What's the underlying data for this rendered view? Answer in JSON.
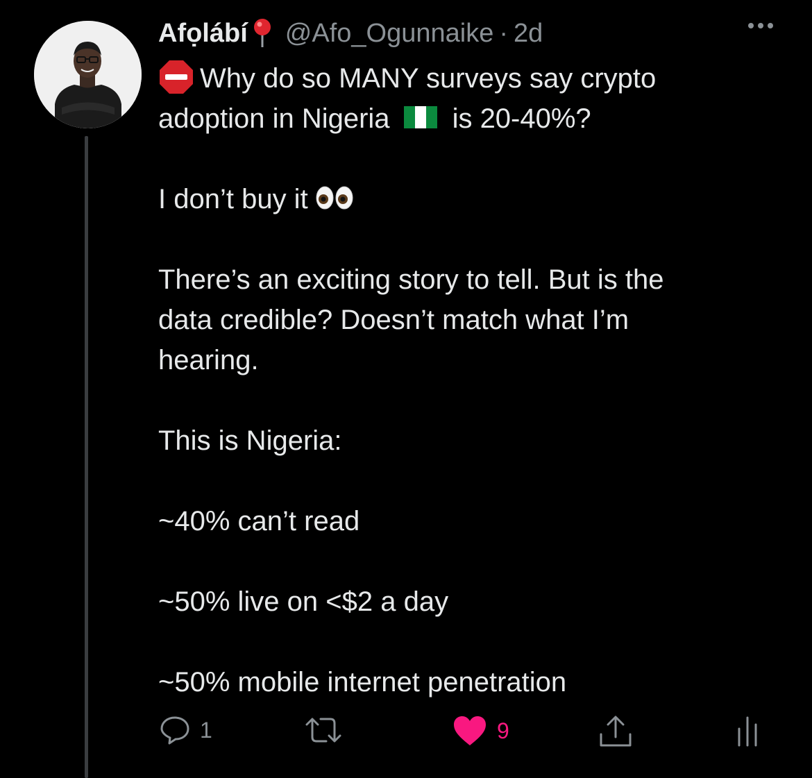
{
  "tweet": {
    "author": {
      "name": "Afọlábí",
      "handle": "@Afo_Ogunnaike",
      "separator": "·",
      "time": "2d",
      "pin_icon": "round-pushpin-emoji"
    },
    "lines": [
      {
        "text": "Why do so MANY surveys say crypto",
        "lead_icon": "stop-sign-emoji"
      },
      {
        "text_before": "adoption in Nigeria",
        "text_after": "is 20-40%?",
        "inline_icon": "nigeria-flag-emoji"
      },
      {
        "text": ""
      },
      {
        "text": "I don’t buy it",
        "trail_icon": "eyes-emoji"
      },
      {
        "text": ""
      },
      {
        "text": "There’s an exciting story to tell. But is the"
      },
      {
        "text": "data credible? Doesn’t match what I’m"
      },
      {
        "text": "hearing."
      },
      {
        "text": ""
      },
      {
        "text": "This is Nigeria:"
      },
      {
        "text": ""
      },
      {
        "text": "~40% can’t read"
      },
      {
        "text": ""
      },
      {
        "text": "~50% live on <$2 a day"
      },
      {
        "text": ""
      },
      {
        "text": "~50% mobile internet penetration"
      }
    ],
    "actions": {
      "replies": "1",
      "retweets": "",
      "likes": "9",
      "liked": true
    }
  },
  "colors": {
    "background": "#000000",
    "text": "#e7e9ea",
    "muted": "#8b9196",
    "like": "#f91880"
  }
}
